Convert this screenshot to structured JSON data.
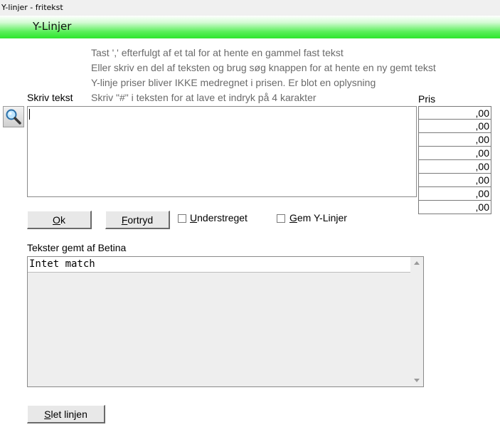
{
  "window": {
    "title": "Y-linjer - fritekst"
  },
  "header": {
    "title": "Y-Linjer"
  },
  "hints": [
    "Tast ',' efterfulgt af et tal for at hente en gammel fast tekst",
    "Eller skriv en del af teksten og brug søg knappen for at hente en ny gemt tekst",
    "Y-linje priser bliver IKKE medregnet i prisen. Er blot en oplysning",
    "Skriv \"#\" i teksten for at lave et indryk på 4 karakter"
  ],
  "form": {
    "text_label": "Skriv tekst",
    "text_value": "",
    "price_label": "Pris",
    "prices": [
      ",00",
      ",00",
      ",00",
      ",00",
      ",00",
      ",00",
      ",00",
      ",00"
    ]
  },
  "buttons": {
    "ok": "Ok",
    "cancel": "Fortryd",
    "delete": "Slet linjen"
  },
  "checkboxes": {
    "underline": {
      "label": "Understreget",
      "checked": false
    },
    "save_lines": {
      "label": "Gem Y-Linjer",
      "checked": false
    }
  },
  "saved_texts": {
    "label": "Tekster gemt af Betina",
    "items": [
      "Intet match"
    ]
  },
  "icons": {
    "search": "magnifier-icon"
  }
}
